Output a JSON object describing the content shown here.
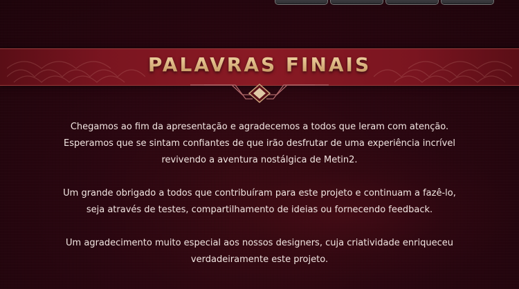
{
  "top_tabs": [
    {
      "label": ""
    },
    {
      "label": ""
    },
    {
      "label": ""
    },
    {
      "label": ""
    }
  ],
  "banner": {
    "title": "PALAVRAS FINAIS"
  },
  "content": {
    "paragraphs": [
      {
        "lines": [
          "Chegamos ao fim da apresentação e agradecemos a todos que leram com atenção.",
          "Esperamos que se sintam confiantes de que irão desfrutar de uma experiência incrível",
          "revivendo a aventura nostálgica de Metin2."
        ]
      },
      {
        "lines": [
          "Um grande obrigado a todos que contribuíram para este projeto e continuam a fazê-lo,",
          "seja através de testes, compartilhamento de ideias ou fornecendo feedback."
        ]
      },
      {
        "lines": [
          "Um agradecimento muito especial aos nossos designers, cuja criatividade enriqueceu",
          "verdadeiramente este projeto."
        ]
      }
    ]
  },
  "colors": {
    "background": "#2a0610",
    "banner": "#8a1a24",
    "title_gold": "#d8b27a",
    "text": "#f2e6e2",
    "ornament": "#c9a07a"
  },
  "icons": {
    "ornament": "diamond-ornament-icon"
  }
}
